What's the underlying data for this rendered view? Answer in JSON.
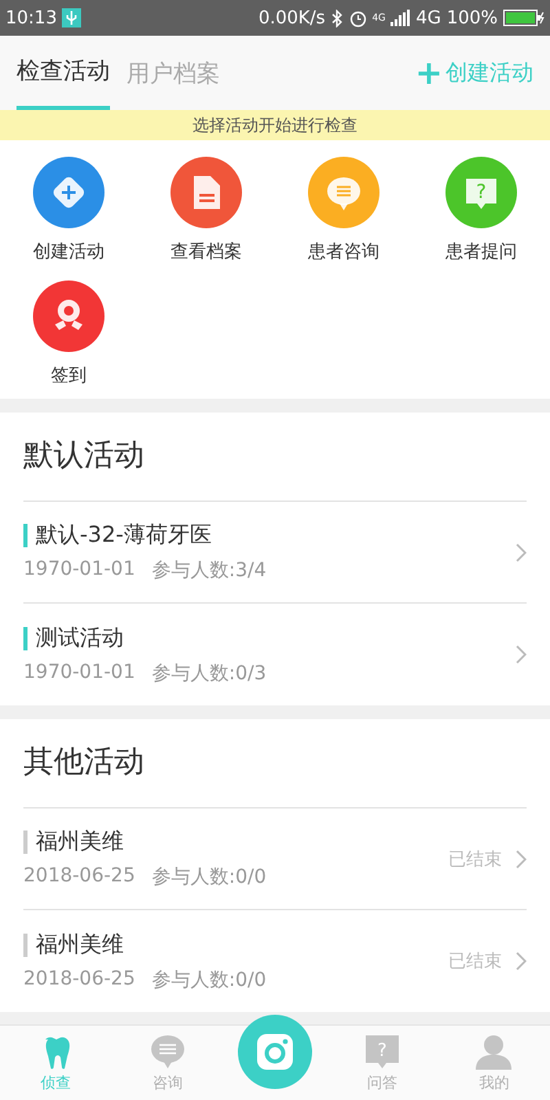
{
  "status_bar": {
    "time": "10:13",
    "speed": "0.00K/s",
    "network_small": "4G",
    "network": "4G",
    "battery": "100%"
  },
  "header": {
    "tabs": [
      {
        "label": "检查活动",
        "selected": true
      },
      {
        "label": "用户档案",
        "selected": false
      }
    ],
    "action": {
      "icon": "+",
      "label": "创建活动"
    }
  },
  "banner": "选择活动开始进行检查",
  "quick_actions": [
    {
      "kind": "create",
      "label": "创建活动",
      "color": "#2b8fe6"
    },
    {
      "kind": "records",
      "label": "查看档案",
      "color": "#f0563a"
    },
    {
      "kind": "consult",
      "label": "患者咨询",
      "color": "#fbae22"
    },
    {
      "kind": "question",
      "label": "患者提问",
      "color": "#4cc52a",
      "glyph": "?"
    },
    {
      "kind": "checkin",
      "label": "签到",
      "color": "#f23636"
    }
  ],
  "sections": [
    {
      "title": "默认活动",
      "activities": [
        {
          "name": "默认-32-薄荷牙医",
          "date": "1970-01-01",
          "participants": "参与人数:3/4",
          "ended": false
        },
        {
          "name": "测试活动",
          "date": "1970-01-01",
          "participants": "参与人数:0/3",
          "ended": false
        }
      ]
    },
    {
      "title": "其他活动",
      "activities": [
        {
          "name": "福州美维",
          "date": "2018-06-25",
          "participants": "参与人数:0/0",
          "ended": true,
          "status": "已结束"
        },
        {
          "name": "福州美维",
          "date": "2018-06-25",
          "participants": "参与人数:0/0",
          "ended": true,
          "status": "已结束"
        }
      ]
    }
  ],
  "bottom_nav": [
    {
      "kind": "tooth",
      "label": "侦查",
      "selected": true
    },
    {
      "kind": "chat",
      "label": "咨询",
      "selected": false
    },
    {
      "kind": "camera"
    },
    {
      "kind": "question",
      "label": "问答",
      "selected": false,
      "glyph": "?"
    },
    {
      "kind": "person",
      "label": "我的",
      "selected": false
    }
  ]
}
